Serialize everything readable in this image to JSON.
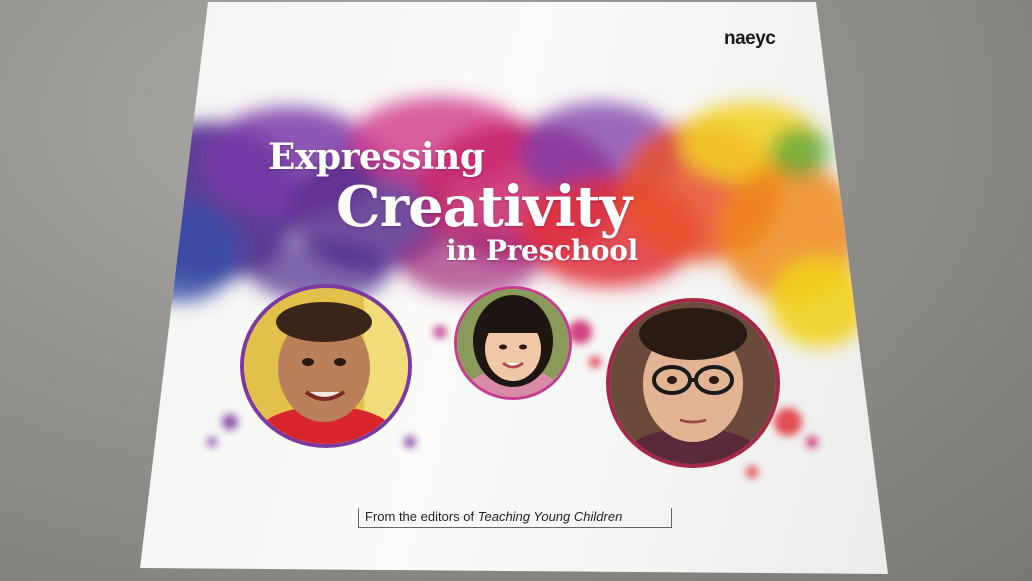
{
  "publisher_logo": "naeyc",
  "title": {
    "line1": "Expressing",
    "line2": "Creativity",
    "line3": "in Preschool"
  },
  "tagline": {
    "prefix": "From the editors of",
    "publication": "Teaching Young Children"
  },
  "photos": [
    {
      "name": "child-photo-boy"
    },
    {
      "name": "child-photo-girl"
    },
    {
      "name": "child-photo-boy-glasses"
    }
  ],
  "colors": {
    "purple": "#5b2d8e",
    "magenta": "#c8246a",
    "red": "#e0303a",
    "orange": "#f08a1c",
    "yellow": "#f2d21e",
    "blue": "#3a4fa8"
  }
}
